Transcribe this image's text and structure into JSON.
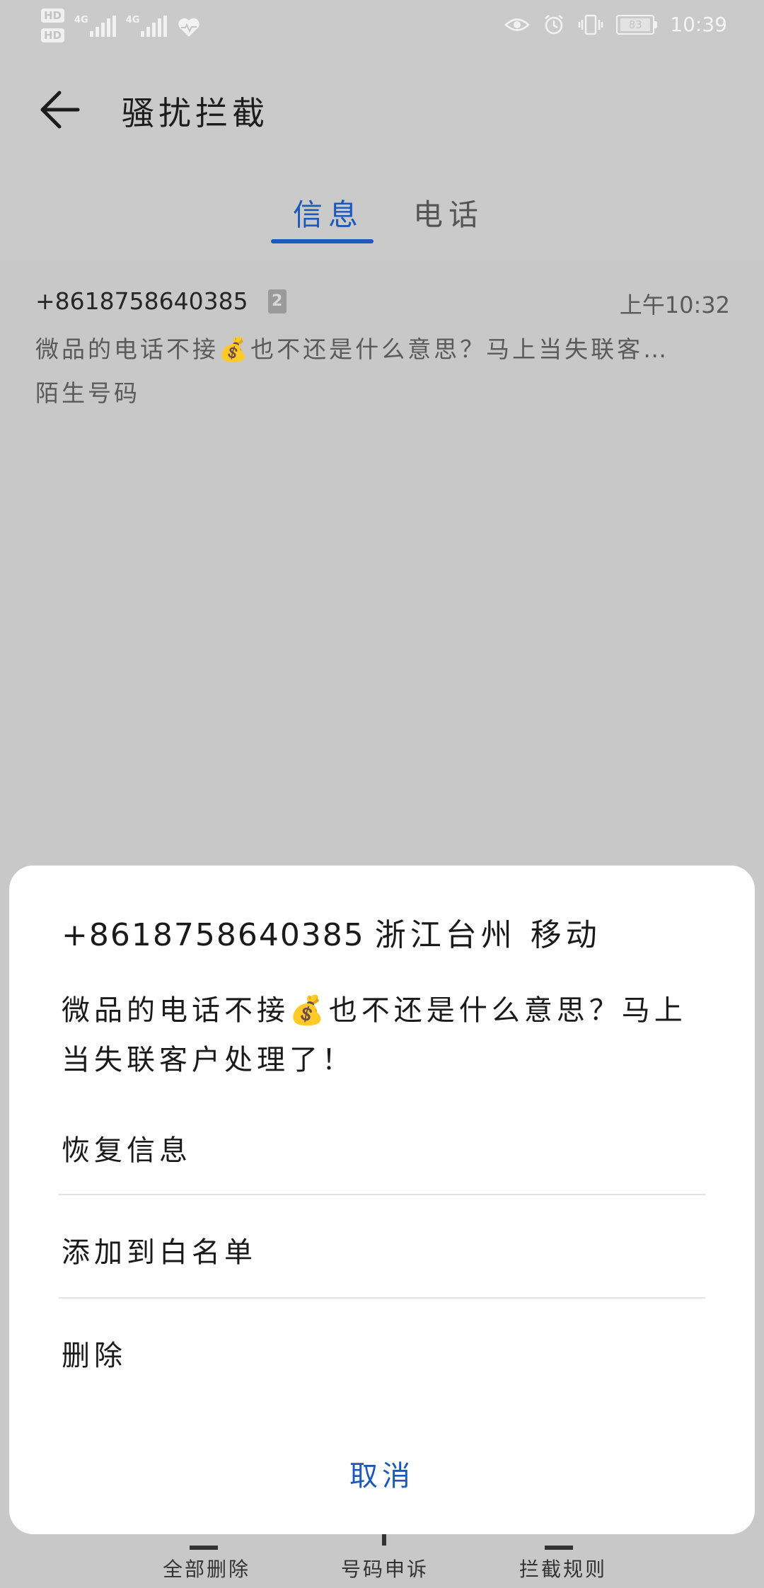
{
  "status_bar": {
    "hd1": "HD",
    "hd2": "HD",
    "net1": "4G",
    "net2": "4G",
    "battery": "83",
    "time": "10:39"
  },
  "app_bar": {
    "title": "骚扰拦截"
  },
  "tabs": [
    {
      "label": "信息",
      "active": true
    },
    {
      "label": "电话",
      "active": false
    }
  ],
  "message": {
    "number": "+8618758640385",
    "sim_badge": "2",
    "time": "上午10:32",
    "preview": "微品的电话不接💰也不还是什么意思？马上当失联客…",
    "tag": "陌生号码"
  },
  "bottom_bar": {
    "items": [
      {
        "label": "全部删除"
      },
      {
        "label": "号码申诉"
      },
      {
        "label": "拦截规则"
      }
    ]
  },
  "sheet": {
    "number": "+8618758640385",
    "location": "浙江台州 移动",
    "body": "微品的电话不接💰也不还是什么意思？马上当失联客户处理了！",
    "actions": [
      {
        "label": "恢复信息"
      },
      {
        "label": "添加到白名单"
      },
      {
        "label": "删除"
      }
    ],
    "cancel": "取消"
  }
}
